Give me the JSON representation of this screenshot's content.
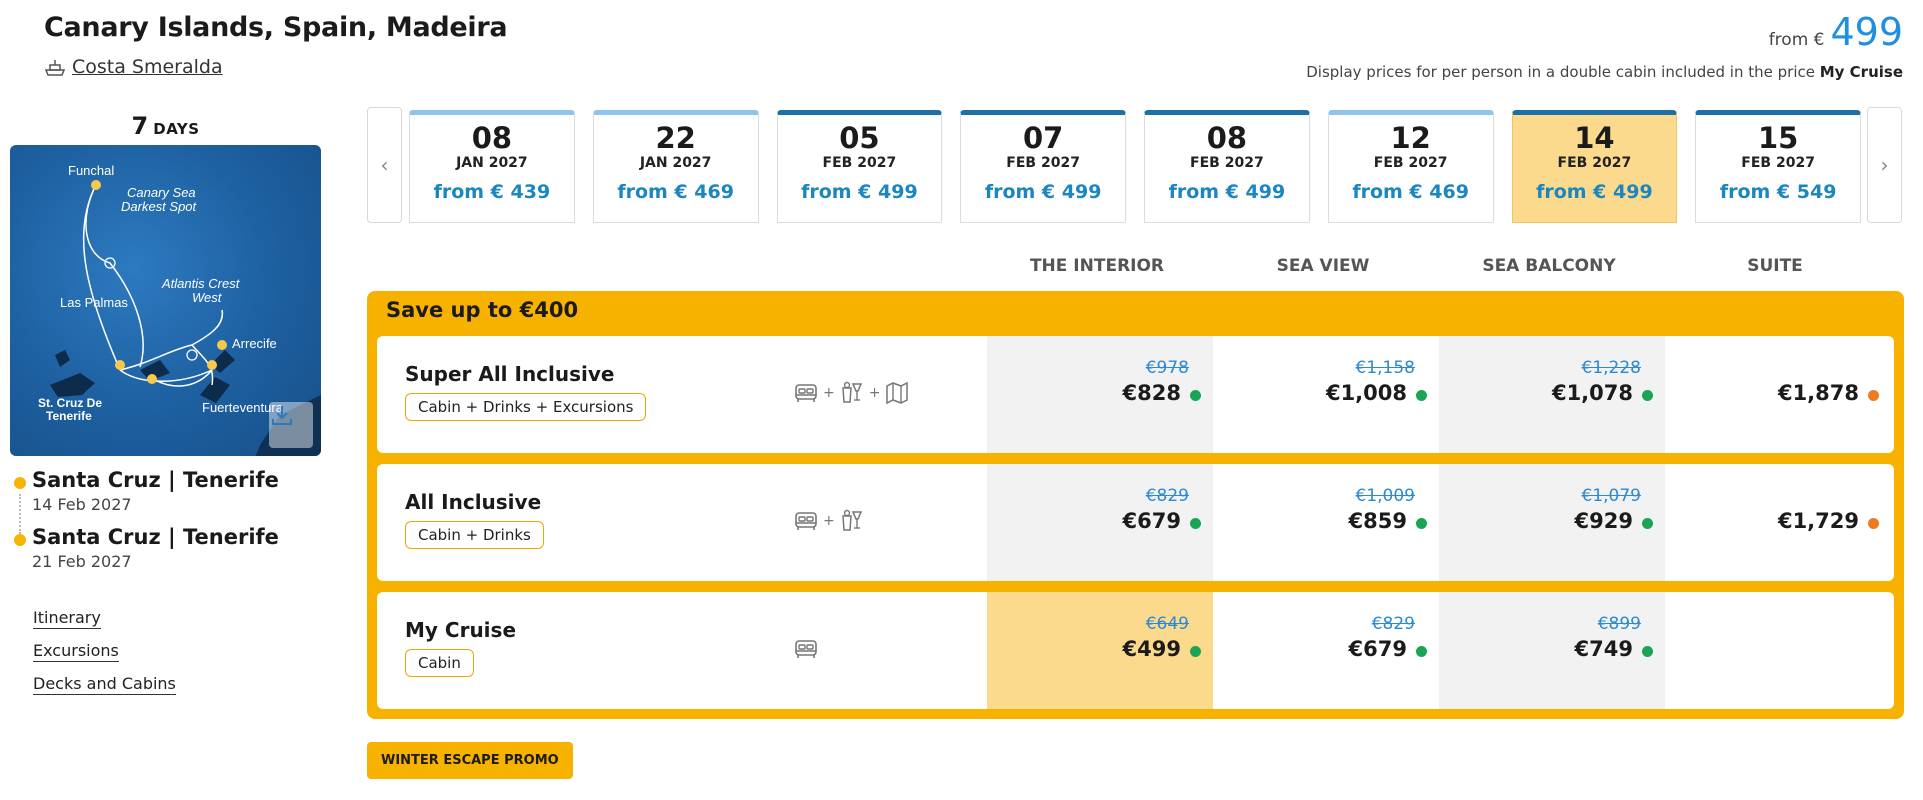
{
  "header": {
    "title": "Canary Islands, Spain, Madeira",
    "ship_name": "Costa Smeralda",
    "from_label": "from €",
    "from_price": "499",
    "price_note_prefix": "Display prices for per person in a double cabin included in the price ",
    "price_note_bold": "My Cruise"
  },
  "duration": {
    "number": "7",
    "label": "DAYS"
  },
  "map": {
    "labels": [
      "Funchal",
      "Canary Sea Darkest Spot",
      "Atlantis Crest West",
      "Las Palmas",
      "Arrecife",
      "St. Cruz De Tenerife",
      "Fuerteventura"
    ],
    "label_lines": {
      "canary": [
        "Canary Sea",
        "Darkest Spot"
      ],
      "atlantis": [
        "Atlantis Crest",
        "West"
      ],
      "tenerife": [
        "St. Cruz De",
        "Tenerife"
      ]
    }
  },
  "itinerary": [
    {
      "port": "Santa Cruz | Tenerife",
      "date": "14 Feb 2027"
    },
    {
      "port": "Santa Cruz | Tenerife",
      "date": "21 Feb 2027"
    }
  ],
  "left_links": [
    "Itinerary",
    "Excursions",
    "Decks and Cabins"
  ],
  "dates": [
    {
      "day": "08",
      "month": "JAN 2027",
      "price": "from € 439",
      "style": "light"
    },
    {
      "day": "22",
      "month": "JAN 2027",
      "price": "from € 469",
      "style": "light"
    },
    {
      "day": "05",
      "month": "FEB 2027",
      "price": "from € 499",
      "style": "dark"
    },
    {
      "day": "07",
      "month": "FEB 2027",
      "price": "from € 499",
      "style": "dark"
    },
    {
      "day": "08",
      "month": "FEB 2027",
      "price": "from € 499",
      "style": "dark"
    },
    {
      "day": "12",
      "month": "FEB 2027",
      "price": "from € 469",
      "style": "light"
    },
    {
      "day": "14",
      "month": "FEB 2027",
      "price": "from € 499",
      "style": "selected"
    },
    {
      "day": "15",
      "month": "FEB 2027",
      "price": "from € 549",
      "style": "dark"
    }
  ],
  "cabin_columns": [
    "THE INTERIOR",
    "SEA VIEW",
    "SEA BALCONY",
    "SUITE"
  ],
  "save_banner": "Save up to €400",
  "packages": [
    {
      "name": "Super All Inclusive",
      "tag": "Cabin + Drinks + Excursions",
      "icons": [
        "bed-icon",
        "drinks-icon",
        "map-icon"
      ],
      "prices": [
        {
          "old": "€978",
          "new": "€828",
          "status": "green"
        },
        {
          "old": "€1,158",
          "new": "€1,008",
          "status": "green"
        },
        {
          "old": "€1,228",
          "new": "€1,078",
          "status": "green"
        },
        {
          "old": "",
          "new": "€1,878",
          "status": "orange"
        }
      ]
    },
    {
      "name": "All Inclusive",
      "tag": "Cabin + Drinks",
      "icons": [
        "bed-icon",
        "drinks-icon"
      ],
      "prices": [
        {
          "old": "€829",
          "new": "€679",
          "status": "green"
        },
        {
          "old": "€1,009",
          "new": "€859",
          "status": "green"
        },
        {
          "old": "€1,079",
          "new": "€929",
          "status": "green"
        },
        {
          "old": "",
          "new": "€1,729",
          "status": "orange"
        }
      ]
    },
    {
      "name": "My Cruise",
      "tag": "Cabin",
      "icons": [
        "bed-icon"
      ],
      "prices": [
        {
          "old": "€649",
          "new": "€499",
          "status": "green"
        },
        {
          "old": "€829",
          "new": "€679",
          "status": "green"
        },
        {
          "old": "€899",
          "new": "€749",
          "status": "green"
        },
        {
          "old": "",
          "new": "",
          "status": ""
        }
      ]
    }
  ],
  "promo_label": "WINTER ESCAPE PROMO",
  "colors": {
    "accent_yellow": "#f7b200",
    "selected_bg": "#fbda8d",
    "price_blue": "#1b86c0",
    "available_green": "#1ca456",
    "limited_orange": "#f07a23"
  }
}
